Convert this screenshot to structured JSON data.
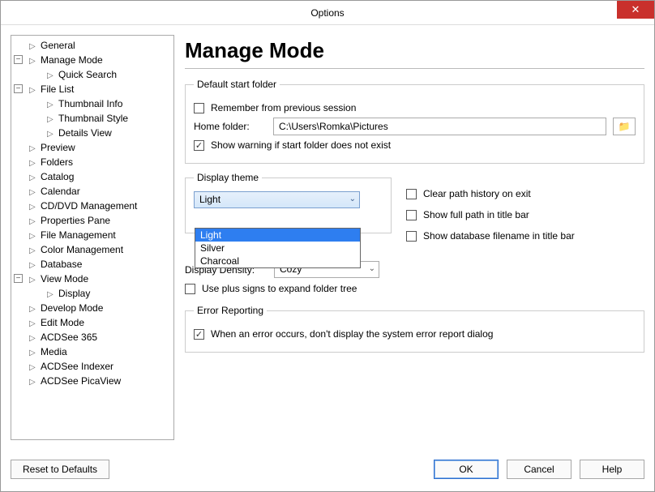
{
  "window": {
    "title": "Options"
  },
  "tree": {
    "items": [
      "General",
      "Manage Mode",
      "Quick Search",
      "File List",
      "Thumbnail Info",
      "Thumbnail Style",
      "Details View",
      "Preview",
      "Folders",
      "Catalog",
      "Calendar",
      "CD/DVD Management",
      "Properties Pane",
      "File Management",
      "Color Management",
      "Database",
      "View Mode",
      "Display",
      "Develop Mode",
      "Edit Mode",
      "ACDSee 365",
      "Media",
      "ACDSee Indexer",
      "ACDSee PicaView"
    ]
  },
  "page": {
    "heading": "Manage Mode",
    "default_folder": {
      "legend": "Default start folder",
      "remember": "Remember from previous session",
      "home_label": "Home folder:",
      "home_value": "C:\\Users\\Romka\\Pictures",
      "warn": "Show warning if start folder does not exist"
    },
    "theme": {
      "legend": "Display theme",
      "value": "Light",
      "options": [
        "Light",
        "Silver",
        "Charcoal"
      ]
    },
    "right_checks": {
      "clear_history": "Clear path history on exit",
      "full_path": "Show full path in title bar",
      "db_filename": "Show database filename in title bar"
    },
    "density": {
      "label": "Display Density:",
      "value": "Cozy"
    },
    "plus_signs": "Use plus signs to expand folder tree",
    "error": {
      "legend": "Error Reporting",
      "dont_display": "When an error occurs, don't display the system error report dialog"
    }
  },
  "buttons": {
    "reset": "Reset to Defaults",
    "ok": "OK",
    "cancel": "Cancel",
    "help": "Help"
  }
}
